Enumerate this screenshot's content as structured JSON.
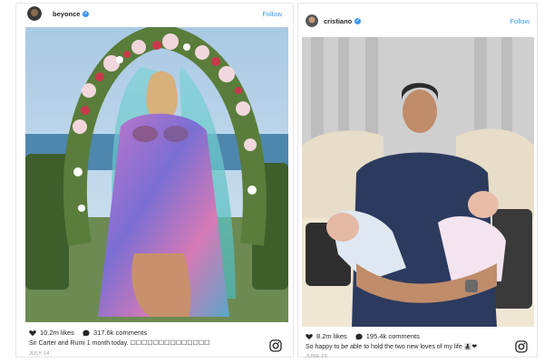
{
  "colors": {
    "link_blue": "#3897f0",
    "text_dark": "#262626",
    "date_gray": "#999999",
    "border": "#e6e6e6"
  },
  "posts": [
    {
      "username": "beyonce",
      "follow_label": "Follow",
      "likes": "10.2m likes",
      "comments": "317.6k comments",
      "caption": "Sir Carter and Rumi 1 month today. ☐☐☐☐☐☐☐☐☐☐☐☐☐☐",
      "date": "JULY 14",
      "icons": [
        "heart-icon",
        "comment-icon",
        "instagram-logo-icon",
        "verified-badge-icon"
      ]
    },
    {
      "username": "cristiano",
      "follow_label": "Follow",
      "likes": "8.2m likes",
      "comments": "195.4k comments",
      "caption": "So happy to be able to hold the two new loves of my life 👨‍👧‍👦❤",
      "date": "JUNE 29",
      "icons": [
        "heart-icon",
        "comment-icon",
        "instagram-logo-icon",
        "verified-badge-icon"
      ]
    }
  ]
}
